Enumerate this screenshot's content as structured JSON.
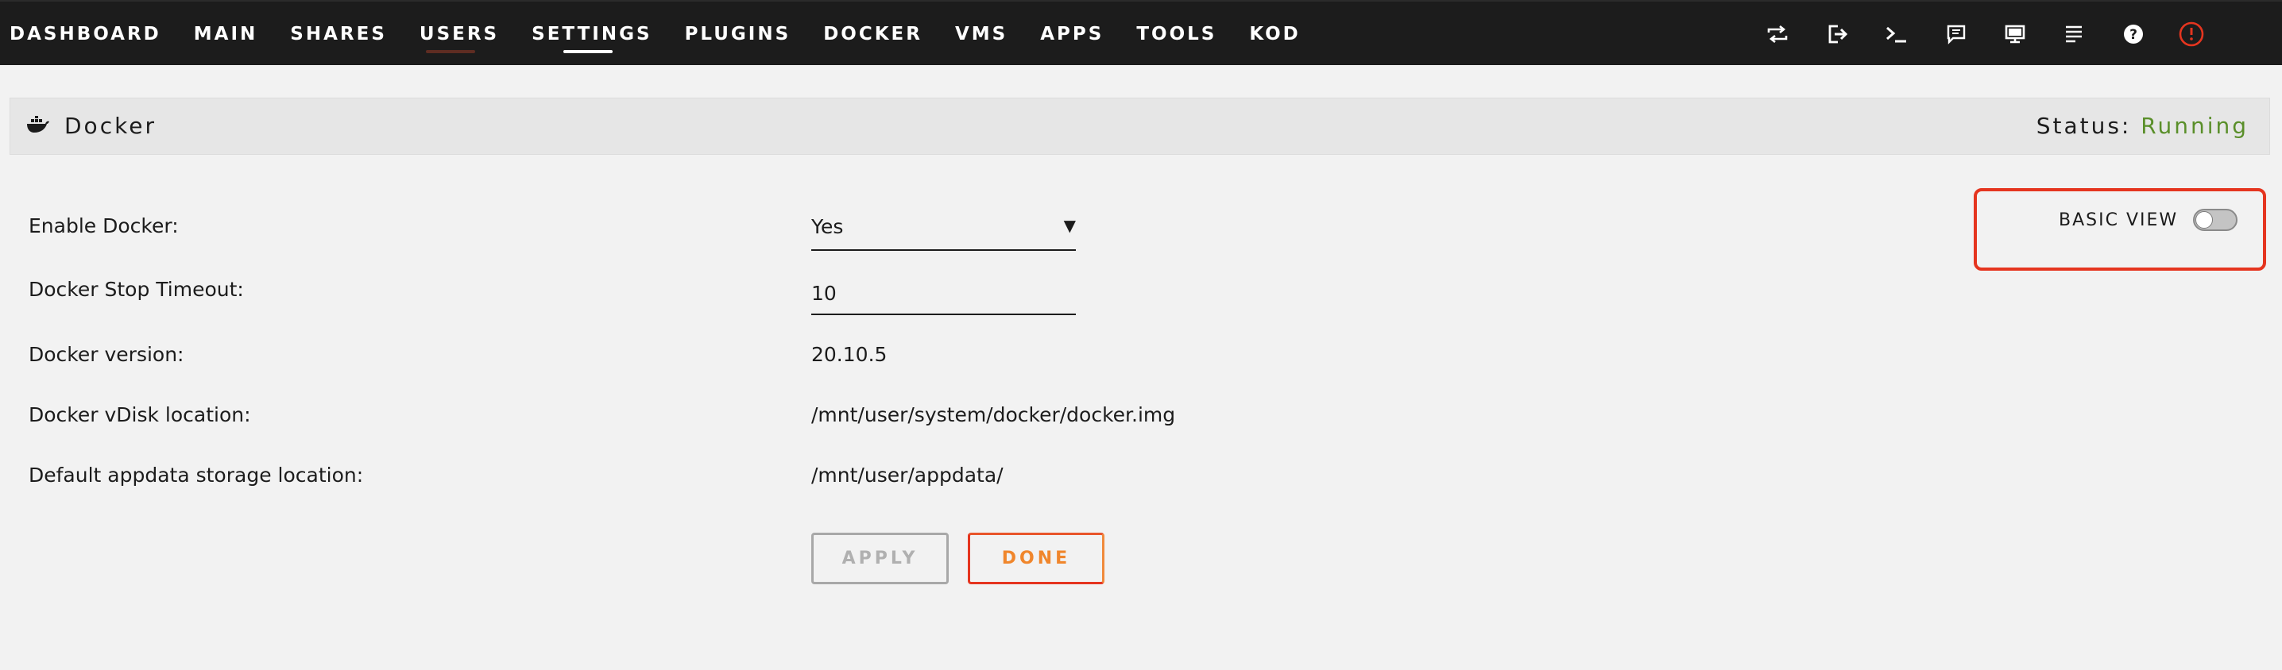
{
  "nav": {
    "items": [
      {
        "label": "DASHBOARD"
      },
      {
        "label": "MAIN"
      },
      {
        "label": "SHARES"
      },
      {
        "label": "USERS"
      },
      {
        "label": "SETTINGS"
      },
      {
        "label": "PLUGINS"
      },
      {
        "label": "DOCKER"
      },
      {
        "label": "VMS"
      },
      {
        "label": "APPS"
      },
      {
        "label": "TOOLS"
      },
      {
        "label": "KOD"
      }
    ],
    "active": "SETTINGS",
    "icons": [
      "refresh-icon",
      "logout-icon",
      "terminal-icon",
      "feedback-icon",
      "monitor-icon",
      "log-icon",
      "help-icon",
      "power-icon"
    ]
  },
  "header": {
    "title": "Docker",
    "status_label": "Status:",
    "status_value": "Running"
  },
  "view_toggle": {
    "label": "BASIC VIEW",
    "enabled": false
  },
  "form": {
    "enable_docker": {
      "label": "Enable Docker:",
      "value": "Yes"
    },
    "stop_timeout": {
      "label": "Docker Stop Timeout:",
      "value": "10"
    },
    "version": {
      "label": "Docker version:",
      "value": "20.10.5"
    },
    "vdisk": {
      "label": "Docker vDisk location:",
      "value": "/mnt/user/system/docker/docker.img"
    },
    "appdata": {
      "label": "Default appdata storage location:",
      "value": "/mnt/user/appdata/"
    }
  },
  "buttons": {
    "apply": "APPLY",
    "done": "DONE"
  },
  "colors": {
    "accent": "#e5351f",
    "running": "#5a8f2a",
    "done_text": "#f0862c"
  }
}
